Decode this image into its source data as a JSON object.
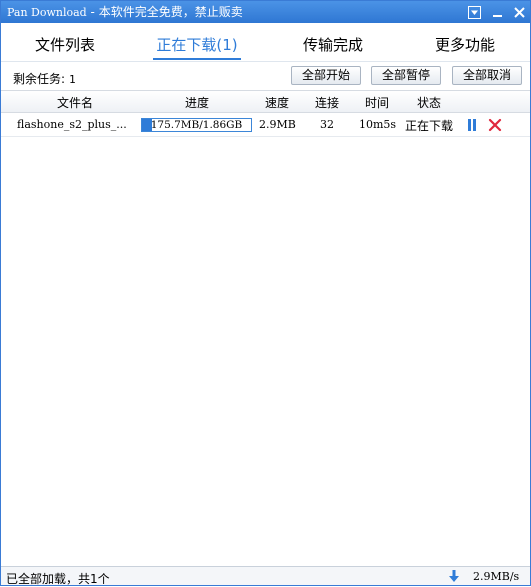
{
  "window": {
    "title_app": "Pan Download",
    "title_rest": " - 本软件完全免费，禁止贩卖",
    "accent": "#2f7cd8",
    "titlebar_color": "#3a82dd"
  },
  "tabs": [
    {
      "label": "文件列表",
      "active": false
    },
    {
      "label": "正在下载(1)",
      "active": true
    },
    {
      "label": "传输完成",
      "active": false
    },
    {
      "label": "更多功能",
      "active": false
    }
  ],
  "toolbar": {
    "remaining_label": "剩余任务:",
    "remaining_count": "1",
    "start_all": "全部开始",
    "pause_all": "全部暂停",
    "cancel_all": "全部取消"
  },
  "table": {
    "headers": [
      "文件名",
      "进度",
      "速度",
      "连接",
      "时间",
      "状态"
    ],
    "rows": [
      {
        "filename": "flashone_s2_plus_...",
        "progress_text": "175.7MB/1.86GB",
        "progress_fraction": 0.092,
        "speed": "2.9MB",
        "connections": "32",
        "time": "10m5s",
        "status": "正在下载"
      }
    ]
  },
  "statusbar": {
    "text": "已全部加载，共1个",
    "speed": "2.9MB/s"
  },
  "icons": {
    "menu": "dropdown-menu-icon",
    "minimize": "minimize-icon",
    "close": "close-icon",
    "pause": "pause-icon",
    "delete": "delete-x-icon",
    "download": "download-arrow-icon"
  }
}
